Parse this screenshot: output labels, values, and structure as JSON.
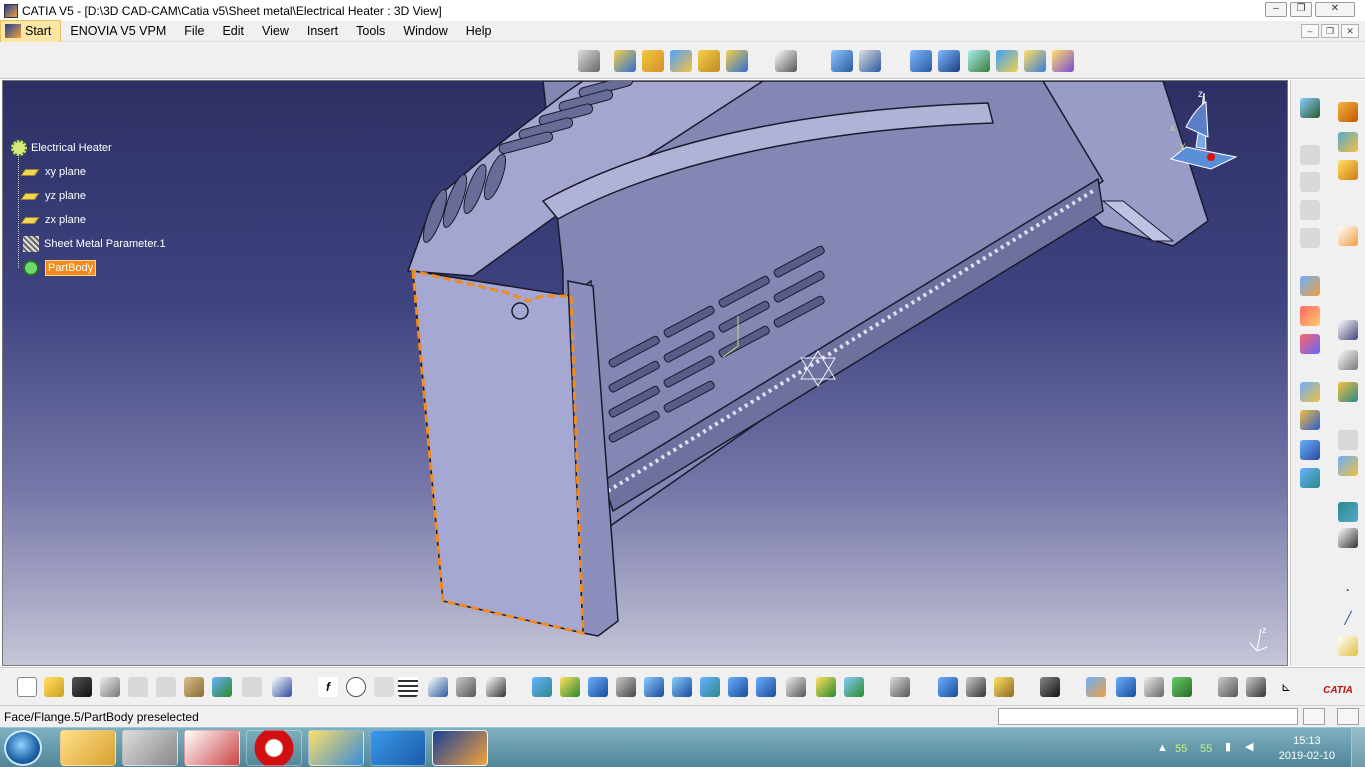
{
  "window": {
    "title": "CATIA V5 - [D:\\3D CAD-CAM\\Catia v5\\Sheet metal\\Electrical Heater : 3D View]",
    "controls": [
      "minimize",
      "restore",
      "close"
    ]
  },
  "menu": {
    "items": [
      "Start",
      "ENOVIA V5 VPM",
      "File",
      "Edit",
      "View",
      "Insert",
      "Tools",
      "Window",
      "Help"
    ]
  },
  "tree": {
    "root": "Electrical Heater",
    "items": [
      "xy plane",
      "yz plane",
      "zx plane",
      "Sheet Metal Parameter.1",
      "PartBody"
    ],
    "selected_index": 4
  },
  "compass": {
    "axes": [
      "z",
      "x",
      "y"
    ]
  },
  "corner_axes": {
    "label": "z"
  },
  "status": {
    "message": "Face/Flange.5/PartBody preselected",
    "command_value": ""
  },
  "taskbar": {
    "apps": [
      "windows-explorer",
      "calculator",
      "snipping-tool",
      "opera",
      "paint",
      "screen-capture",
      "catia"
    ],
    "active_index": 6,
    "tray_values": [
      "55",
      "55"
    ],
    "time": "15:13",
    "date": "2019-02-10"
  },
  "icons": {
    "catia_logo": "catia-3ds-icon",
    "bottom_right_logo": "CATIA"
  },
  "colors": {
    "background_top": "#2e2f64",
    "background_bottom": "#c6c6d8",
    "model": "#9a9cc8",
    "highlight": "#f28a1c",
    "selection": "#f28a1c"
  }
}
